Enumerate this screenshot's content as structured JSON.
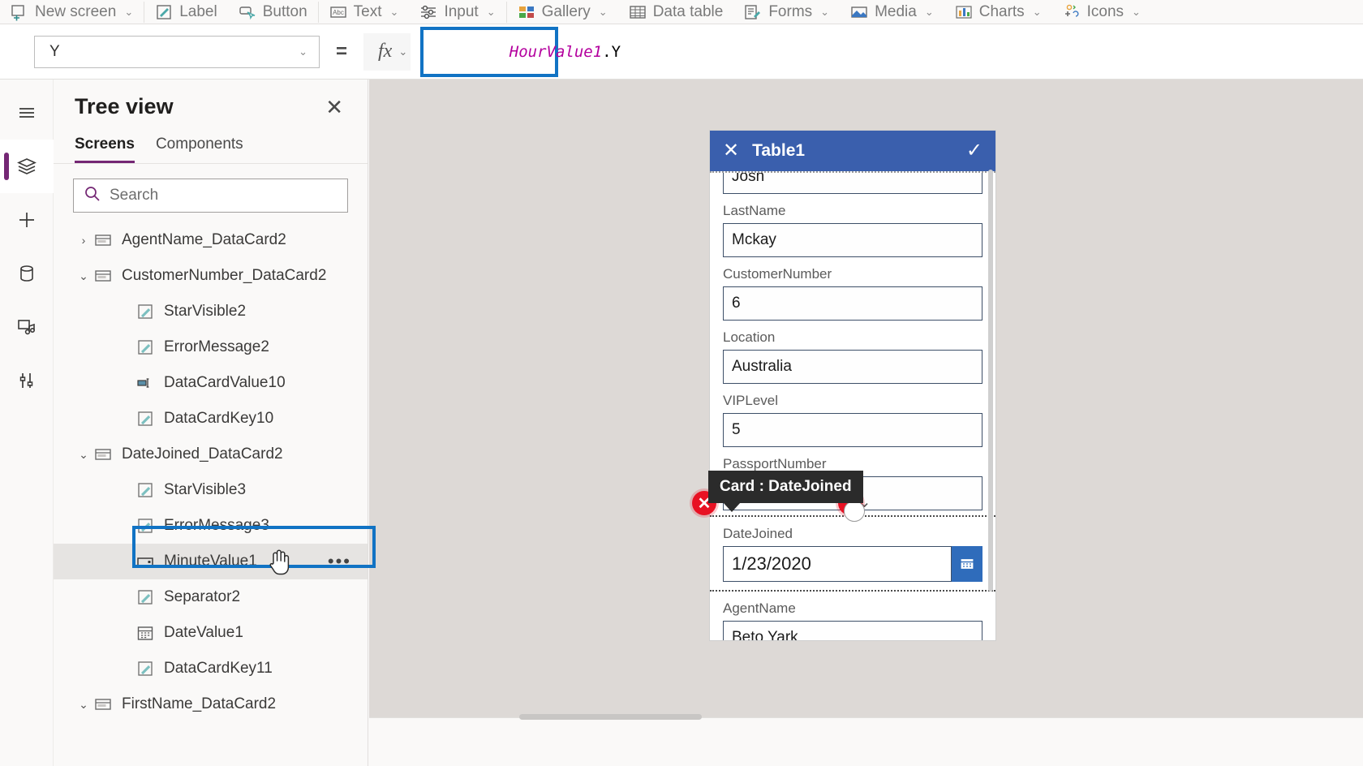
{
  "ribbon": {
    "items": [
      {
        "label": "New screen",
        "icon": "new-screen-icon",
        "chevron": "⌄"
      },
      {
        "label": "Label",
        "icon": "label-icon",
        "chevron": ""
      },
      {
        "label": "Button",
        "icon": "button-icon",
        "chevron": ""
      },
      {
        "label": "Text",
        "icon": "text-icon",
        "chevron": "⌄"
      },
      {
        "label": "Input",
        "icon": "input-icon",
        "chevron": "⌄"
      },
      {
        "label": "Gallery",
        "icon": "gallery-icon",
        "chevron": "⌄"
      },
      {
        "label": "Data table",
        "icon": "data-table-icon",
        "chevron": ""
      },
      {
        "label": "Forms",
        "icon": "forms-icon",
        "chevron": "⌄"
      },
      {
        "label": "Media",
        "icon": "media-icon",
        "chevron": "⌄"
      },
      {
        "label": "Charts",
        "icon": "charts-icon",
        "chevron": "⌄"
      },
      {
        "label": "Icons",
        "icon": "icons-icon",
        "chevron": "⌄"
      }
    ]
  },
  "formula_bar": {
    "property_value": "Y",
    "property_chevron": "⌄",
    "equals": "=",
    "fx_label": "fx",
    "fx_chevron": "⌄",
    "formula_identifier": "HourValue1",
    "formula_dot": ".",
    "formula_property": "Y",
    "highlight_color": "#1173c4"
  },
  "rail": {
    "items": [
      {
        "name": "hamburger-menu-icon",
        "active": false
      },
      {
        "name": "tree-view-icon",
        "active": true
      },
      {
        "name": "insert-icon",
        "active": false
      },
      {
        "name": "data-icon",
        "active": false
      },
      {
        "name": "media-icon",
        "active": false
      },
      {
        "name": "advanced-tools-icon",
        "active": false
      }
    ],
    "active_indicator_color": "#742774"
  },
  "tree_panel": {
    "title": "Tree view",
    "close_label": "✕",
    "tabs": [
      {
        "label": "Screens",
        "selected": true
      },
      {
        "label": "Components",
        "selected": false
      }
    ],
    "search": {
      "placeholder": "Search",
      "value": ""
    },
    "items": [
      {
        "label": "AgentName_DataCard2",
        "indent": 1,
        "chevron": "›",
        "icon": "datacard-icon",
        "selected": false,
        "dots": ""
      },
      {
        "label": "CustomerNumber_DataCard2",
        "indent": 1,
        "chevron": "⌄",
        "icon": "datacard-icon",
        "selected": false,
        "dots": ""
      },
      {
        "label": "StarVisible2",
        "indent": 2,
        "chevron": "",
        "icon": "label-control-icon",
        "selected": false,
        "dots": ""
      },
      {
        "label": "ErrorMessage2",
        "indent": 2,
        "chevron": "",
        "icon": "label-control-icon",
        "selected": false,
        "dots": ""
      },
      {
        "label": "DataCardValue10",
        "indent": 2,
        "chevron": "",
        "icon": "text-input-icon",
        "selected": false,
        "dots": ""
      },
      {
        "label": "DataCardKey10",
        "indent": 2,
        "chevron": "",
        "icon": "label-control-icon",
        "selected": false,
        "dots": ""
      },
      {
        "label": "DateJoined_DataCard2",
        "indent": 1,
        "chevron": "⌄",
        "icon": "datacard-icon",
        "selected": false,
        "dots": ""
      },
      {
        "label": "StarVisible3",
        "indent": 2,
        "chevron": "",
        "icon": "label-control-icon",
        "selected": false,
        "dots": ""
      },
      {
        "label": "ErrorMessage3",
        "indent": 2,
        "chevron": "",
        "icon": "label-control-icon",
        "selected": false,
        "dots": ""
      },
      {
        "label": "MinuteValue1",
        "indent": 2,
        "chevron": "",
        "icon": "dropdown-control-icon",
        "selected": true,
        "dots": "•••"
      },
      {
        "label": "Separator2",
        "indent": 2,
        "chevron": "",
        "icon": "label-control-icon",
        "selected": false,
        "dots": ""
      },
      {
        "label": "DateValue1",
        "indent": 2,
        "chevron": "",
        "icon": "date-picker-icon",
        "selected": false,
        "dots": ""
      },
      {
        "label": "DataCardKey11",
        "indent": 2,
        "chevron": "",
        "icon": "label-control-icon",
        "selected": false,
        "dots": ""
      },
      {
        "label": "FirstName_DataCard2",
        "indent": 1,
        "chevron": "⌄",
        "icon": "datacard-icon",
        "selected": false,
        "dots": ""
      }
    ],
    "selection_outline_color": "#1173c4"
  },
  "form": {
    "header": {
      "title": "Table1",
      "close_label": "✕",
      "check_label": "✓",
      "bar_color": "#3a5fad"
    },
    "fields": [
      {
        "label": "",
        "value": "Josh",
        "type": "text",
        "selected": false
      },
      {
        "label": "LastName",
        "value": "Mckay",
        "type": "text",
        "selected": false
      },
      {
        "label": "CustomerNumber",
        "value": "6",
        "type": "text",
        "selected": false
      },
      {
        "label": "Location",
        "value": "Australia",
        "type": "text",
        "selected": false
      },
      {
        "label": "VIPLevel",
        "value": "5",
        "type": "text",
        "selected": false
      },
      {
        "label": "PassportNumber",
        "value": "",
        "type": "text",
        "selected": false
      },
      {
        "label": "DateJoined",
        "value": "1/23/2020",
        "type": "date",
        "selected": true
      },
      {
        "label": "AgentName",
        "value": "Beto Yark",
        "type": "text",
        "selected": false
      }
    ],
    "tooltip": "Card : DateJoined",
    "error_badge_label": "✕",
    "error_color": "#e81123"
  }
}
